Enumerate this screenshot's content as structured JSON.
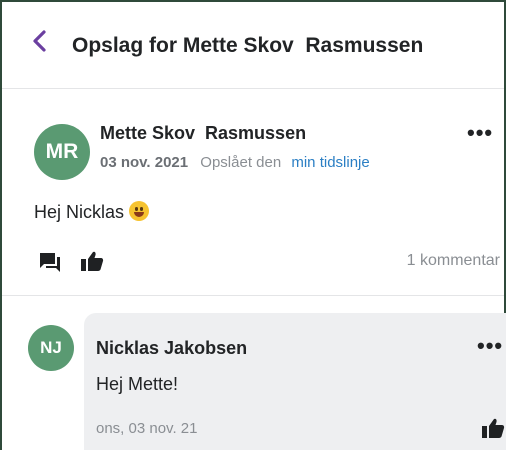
{
  "header": {
    "title": "Opslag for Mette Skov  Rasmussen"
  },
  "post": {
    "avatar_initials": "MR",
    "author": "Mette Skov  Rasmussen",
    "date": "03 nov. 2021",
    "posted_text": "Opslået den",
    "timeline_link": "min tidslinje",
    "body": "Hej Nicklas",
    "emoji": "smiling-face-emoji",
    "comment_count": "1 kommentar"
  },
  "comment": {
    "avatar_initials": "NJ",
    "author": "Nicklas Jakobsen",
    "text": "Hej Mette!",
    "date": "ons, 03 nov. 21"
  },
  "colors": {
    "accent": "#6b3fa0",
    "avatar": "#5a9a72",
    "link": "#2b7fc4",
    "bubble": "#eeeff1"
  }
}
